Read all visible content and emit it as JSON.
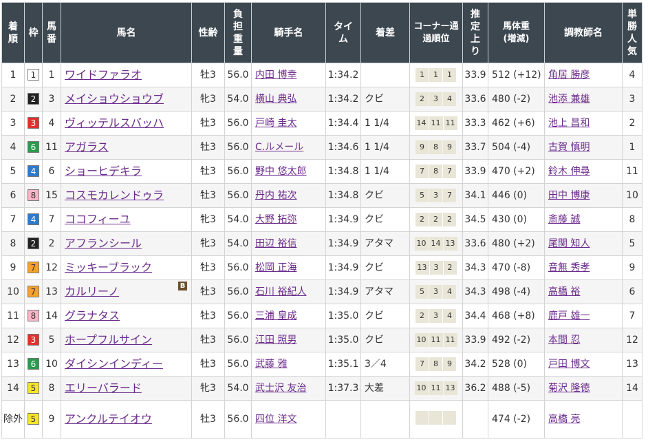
{
  "headers": {
    "rank": "着順",
    "waku": "枠",
    "umaban": "馬番",
    "horse": "馬名",
    "sexage": "性齢",
    "weight_carried": "負担重量",
    "jockey": "騎手名",
    "time": "タイム",
    "margin": "着差",
    "corner": "コーナー通過順位",
    "last3f": "推定上り",
    "bodyweight": "馬体重(増減)",
    "trainer": "調教師名",
    "popularity": "単勝人気"
  },
  "waku_colors": {
    "1": {
      "bg": "#ffffff",
      "fg": "#333333"
    },
    "2": {
      "bg": "#222222",
      "fg": "#ffffff"
    },
    "3": {
      "bg": "#e03030",
      "fg": "#ffffff"
    },
    "4": {
      "bg": "#2f79d0",
      "fg": "#ffffff"
    },
    "5": {
      "bg": "#f5e42a",
      "fg": "#333333"
    },
    "6": {
      "bg": "#2c9a4c",
      "fg": "#ffffff"
    },
    "7": {
      "bg": "#f3a22e",
      "fg": "#333333"
    },
    "8": {
      "bg": "#f7b6c8",
      "fg": "#333333"
    }
  },
  "rows": [
    {
      "rank": "1",
      "waku": "1",
      "umaban": "1",
      "horse": "ワイドファラオ",
      "sexage": "牡3",
      "wt": "56.0",
      "jockey": "内田 博幸",
      "time": "1:34.2",
      "margin": "",
      "corner": [
        "1",
        "1",
        "1"
      ],
      "last3f": "33.9",
      "bw": "512 (+12)",
      "trainer": "角居 勝彦",
      "pop": "4",
      "blinker": ""
    },
    {
      "rank": "2",
      "waku": "2",
      "umaban": "3",
      "horse": "メイショウショウブ",
      "sexage": "牝3",
      "wt": "54.0",
      "jockey": "横山 典弘",
      "time": "1:34.2",
      "margin": "クビ",
      "corner": [
        "2",
        "3",
        "4"
      ],
      "last3f": "33.6",
      "bw": "480 (-2)",
      "trainer": "池添 兼雄",
      "pop": "3",
      "blinker": ""
    },
    {
      "rank": "3",
      "waku": "3",
      "umaban": "4",
      "horse": "ヴィッテルスバッハ",
      "sexage": "牡3",
      "wt": "56.0",
      "jockey": "戸崎 圭太",
      "time": "1:34.4",
      "margin": "1 1/4",
      "corner": [
        "14",
        "11",
        "11"
      ],
      "last3f": "33.3",
      "bw": "462 (+6)",
      "trainer": "池上 昌和",
      "pop": "2",
      "blinker": ""
    },
    {
      "rank": "4",
      "waku": "6",
      "umaban": "11",
      "horse": "アガラス",
      "sexage": "牡3",
      "wt": "56.0",
      "jockey": "C.ルメール",
      "time": "1:34.6",
      "margin": "1 1/4",
      "corner": [
        "9",
        "8",
        "9"
      ],
      "last3f": "33.7",
      "bw": "504 (-4)",
      "trainer": "古賀 慎明",
      "pop": "1",
      "blinker": ""
    },
    {
      "rank": "5",
      "waku": "4",
      "umaban": "6",
      "horse": "ショーヒデキラ",
      "sexage": "牡3",
      "wt": "56.0",
      "jockey": "野中 悠太郎",
      "time": "1:34.8",
      "margin": "1 1/4",
      "corner": [
        "7",
        "8",
        "7"
      ],
      "last3f": "33.9",
      "bw": "470 (+2)",
      "trainer": "鈴木 伸尋",
      "pop": "11",
      "blinker": ""
    },
    {
      "rank": "6",
      "waku": "8",
      "umaban": "15",
      "horse": "コスモカレンドゥラ",
      "sexage": "牡3",
      "wt": "56.0",
      "jockey": "丹内 祐次",
      "time": "1:34.8",
      "margin": "クビ",
      "corner": [
        "5",
        "3",
        "7"
      ],
      "last3f": "34.1",
      "bw": "446 (0)",
      "trainer": "田中 博康",
      "pop": "10",
      "blinker": ""
    },
    {
      "rank": "7",
      "waku": "4",
      "umaban": "7",
      "horse": "ココフィーユ",
      "sexage": "牝3",
      "wt": "54.0",
      "jockey": "大野 拓弥",
      "time": "1:34.9",
      "margin": "クビ",
      "corner": [
        "2",
        "2",
        "2"
      ],
      "last3f": "34.5",
      "bw": "430 (0)",
      "trainer": "斎藤 誠",
      "pop": "8",
      "blinker": ""
    },
    {
      "rank": "8",
      "waku": "2",
      "umaban": "2",
      "horse": "アフランシール",
      "sexage": "牝3",
      "wt": "54.0",
      "jockey": "田辺 裕信",
      "time": "1:34.9",
      "margin": "アタマ",
      "corner": [
        "10",
        "14",
        "13"
      ],
      "last3f": "33.6",
      "bw": "480 (+2)",
      "trainer": "尾関 知人",
      "pop": "5",
      "blinker": ""
    },
    {
      "rank": "9",
      "waku": "7",
      "umaban": "12",
      "horse": "ミッキーブラック",
      "sexage": "牡3",
      "wt": "56.0",
      "jockey": "松岡 正海",
      "time": "1:34.9",
      "margin": "クビ",
      "corner": [
        "13",
        "3",
        "2"
      ],
      "last3f": "34.3",
      "bw": "470 (-8)",
      "trainer": "音無 秀孝",
      "pop": "9",
      "blinker": ""
    },
    {
      "rank": "10",
      "waku": "7",
      "umaban": "13",
      "horse": "カルリーノ",
      "sexage": "牡3",
      "wt": "56.0",
      "jockey": "石川 裕紀人",
      "time": "1:34.9",
      "margin": "アタマ",
      "corner": [
        "5",
        "3",
        "4"
      ],
      "last3f": "34.3",
      "bw": "498 (-4)",
      "trainer": "高橋 裕",
      "pop": "6",
      "blinker": "B"
    },
    {
      "rank": "11",
      "waku": "8",
      "umaban": "14",
      "horse": "グラナタス",
      "sexage": "牡3",
      "wt": "56.0",
      "jockey": "三浦 皇成",
      "time": "1:35.0",
      "margin": "クビ",
      "corner": [
        "2",
        "3",
        "4"
      ],
      "last3f": "34.4",
      "bw": "468 (+8)",
      "trainer": "鹿戸 雄一",
      "pop": "7",
      "blinker": ""
    },
    {
      "rank": "12",
      "waku": "3",
      "umaban": "5",
      "horse": "ホープフルサイン",
      "sexage": "牡3",
      "wt": "56.0",
      "jockey": "江田 照男",
      "time": "1:35.0",
      "margin": "クビ",
      "corner": [
        "10",
        "11",
        "11"
      ],
      "last3f": "33.9",
      "bw": "492 (-2)",
      "trainer": "本間 忍",
      "pop": "12",
      "blinker": ""
    },
    {
      "rank": "13",
      "waku": "6",
      "umaban": "10",
      "horse": "ダイシンインディー",
      "sexage": "牡3",
      "wt": "56.0",
      "jockey": "武藤 雅",
      "time": "1:35.1",
      "margin": "3／4",
      "corner": [
        "7",
        "8",
        "9"
      ],
      "last3f": "34.2",
      "bw": "528 (0)",
      "trainer": "戸田 博文",
      "pop": "13",
      "blinker": ""
    },
    {
      "rank": "14",
      "waku": "5",
      "umaban": "8",
      "horse": "エリーバラード",
      "sexage": "牝3",
      "wt": "54.0",
      "jockey": "武士沢 友治",
      "time": "1:37.3",
      "margin": "大差",
      "corner": [
        "10",
        "11",
        "13"
      ],
      "last3f": "36.2",
      "bw": "488 (-5)",
      "trainer": "菊沢 隆徳",
      "pop": "14",
      "blinker": ""
    },
    {
      "rank": "除外",
      "waku": "5",
      "umaban": "9",
      "horse": "アンクルテイオウ",
      "sexage": "牡3",
      "wt": "56.0",
      "jockey": "四位 洋文",
      "time": "",
      "margin": "",
      "corner": [
        "",
        "",
        ""
      ],
      "last3f": "",
      "bw": "474 (-2)",
      "trainer": "高橋 亮",
      "pop": "",
      "blinker": ""
    }
  ]
}
